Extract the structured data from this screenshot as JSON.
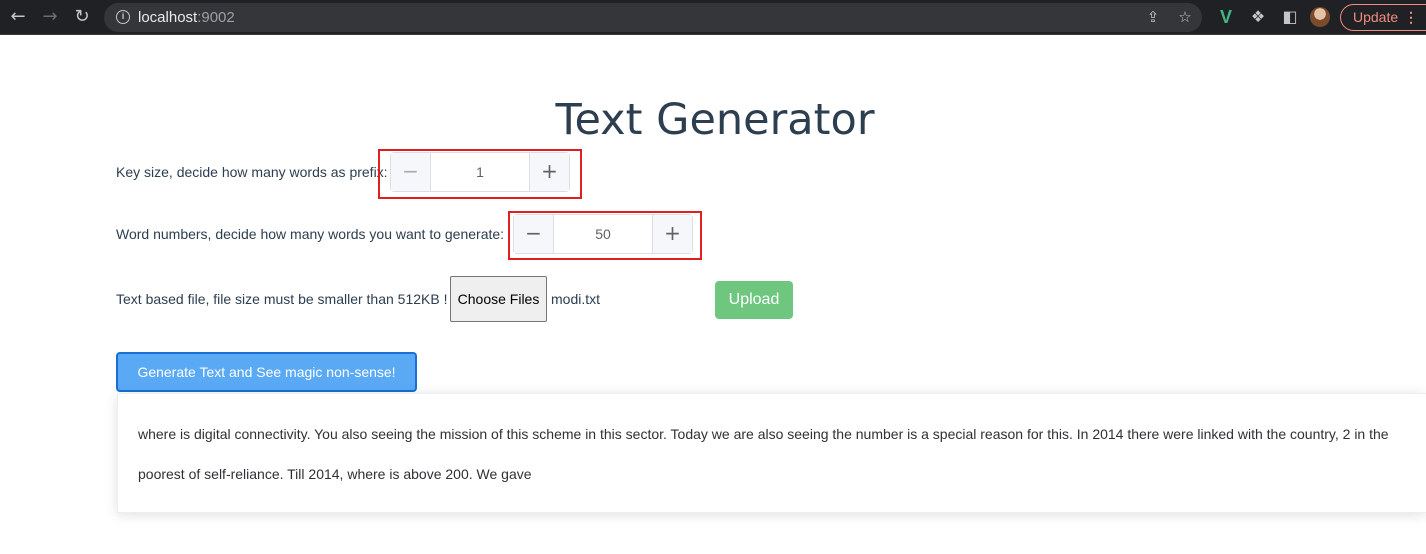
{
  "browser": {
    "url_host": "localhost",
    "url_port": ":9002",
    "update_label": "Update"
  },
  "page": {
    "title": "Text Generator"
  },
  "key_size": {
    "label": "Key size, decide how many words as prefix:",
    "value": "1",
    "dec": "−",
    "inc": "+"
  },
  "word_numbers": {
    "label": "Word numbers, decide how many words you want to generate:",
    "value": "50",
    "dec": "−",
    "inc": "+"
  },
  "file": {
    "label": "Text based file, file size must be smaller than 512KB !",
    "choose_label": "Choose Files",
    "file_name": "modi.txt",
    "upload_label": "Upload"
  },
  "generate": {
    "label": "Generate Text and See magic non-sense!"
  },
  "output": {
    "text": "where is digital connectivity. You also seeing the mission of this scheme in this sector. Today we are also seeing the number is a special reason for this. In 2014 there were linked with the country, 2 in the poorest of self-reliance. Till 2014, where is above 200. We gave"
  },
  "colors": {
    "highlight": "#e02020",
    "upload": "#6fc77f",
    "generate": "#5aa9f5",
    "title": "#2c3e50"
  }
}
